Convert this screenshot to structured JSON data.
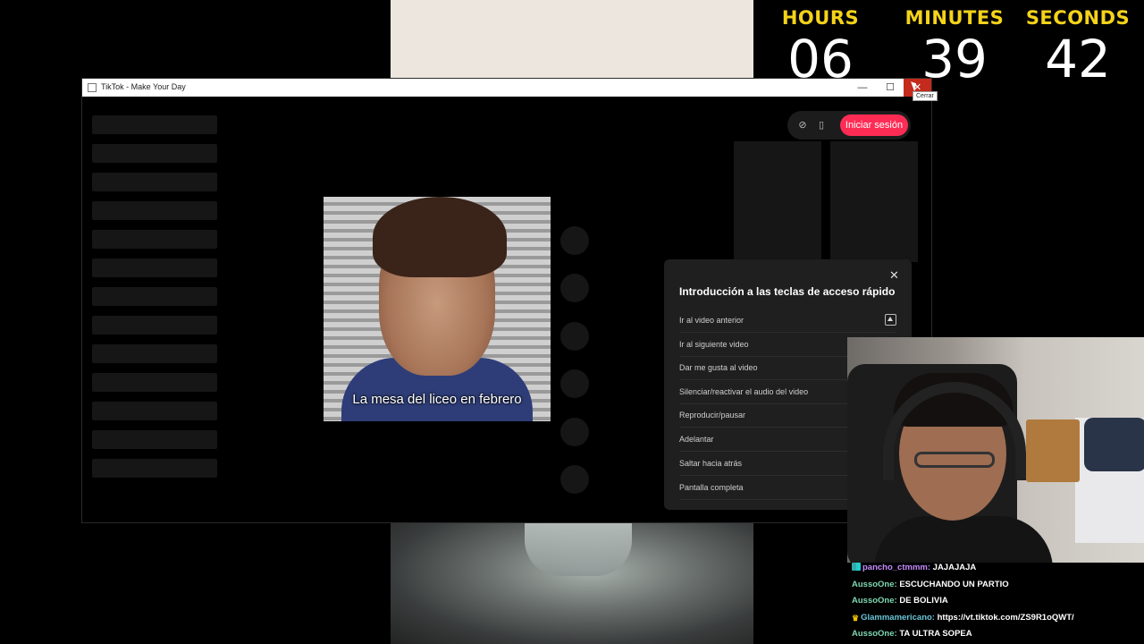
{
  "countdown": {
    "hours_label": "HOURS",
    "minutes_label": "MINUTES",
    "seconds_label": "SECONDS",
    "hours": "06",
    "minutes": "39",
    "seconds": "42"
  },
  "window": {
    "title": "TikTok - Make Your Day",
    "minimize_glyph": "—",
    "maximize_glyph": "☐",
    "close_glyph": "✕",
    "close_tooltip": "Cerrar"
  },
  "header": {
    "compass_icon": "compass-icon",
    "device_icon": "mobile-device-icon",
    "login_label": "Iniciar sesión",
    "login_color": "#fe2c55"
  },
  "video": {
    "caption": "La mesa del liceo en febrero"
  },
  "shortcuts": {
    "close_glyph": "✕",
    "title": "Introducción a las teclas de acceso rápido",
    "items": [
      "Ir al video anterior",
      "Ir al siguiente video",
      "Dar me gusta al video",
      "Silenciar/reactivar el audio del video",
      "Reproducir/pausar",
      "Adelantar",
      "Saltar hacia atrás",
      "Pantalla completa"
    ]
  },
  "chat": [
    {
      "user": "pancho_ctmmm:",
      "message": "JAJAJAJA",
      "badge": "grid"
    },
    {
      "user": "AussoOne:",
      "message": "ESCUCHANDO UN PARTIO",
      "badge": ""
    },
    {
      "user": "AussoOne:",
      "message": "DE BOLIVIA",
      "badge": ""
    },
    {
      "user": "Glammamericano:",
      "message": "https://vt.tiktok.com/ZS9R1oQWT/",
      "badge": "crown"
    },
    {
      "user": "AussoOne:",
      "message": "TA ULTRA SOPEA",
      "badge": ""
    }
  ]
}
